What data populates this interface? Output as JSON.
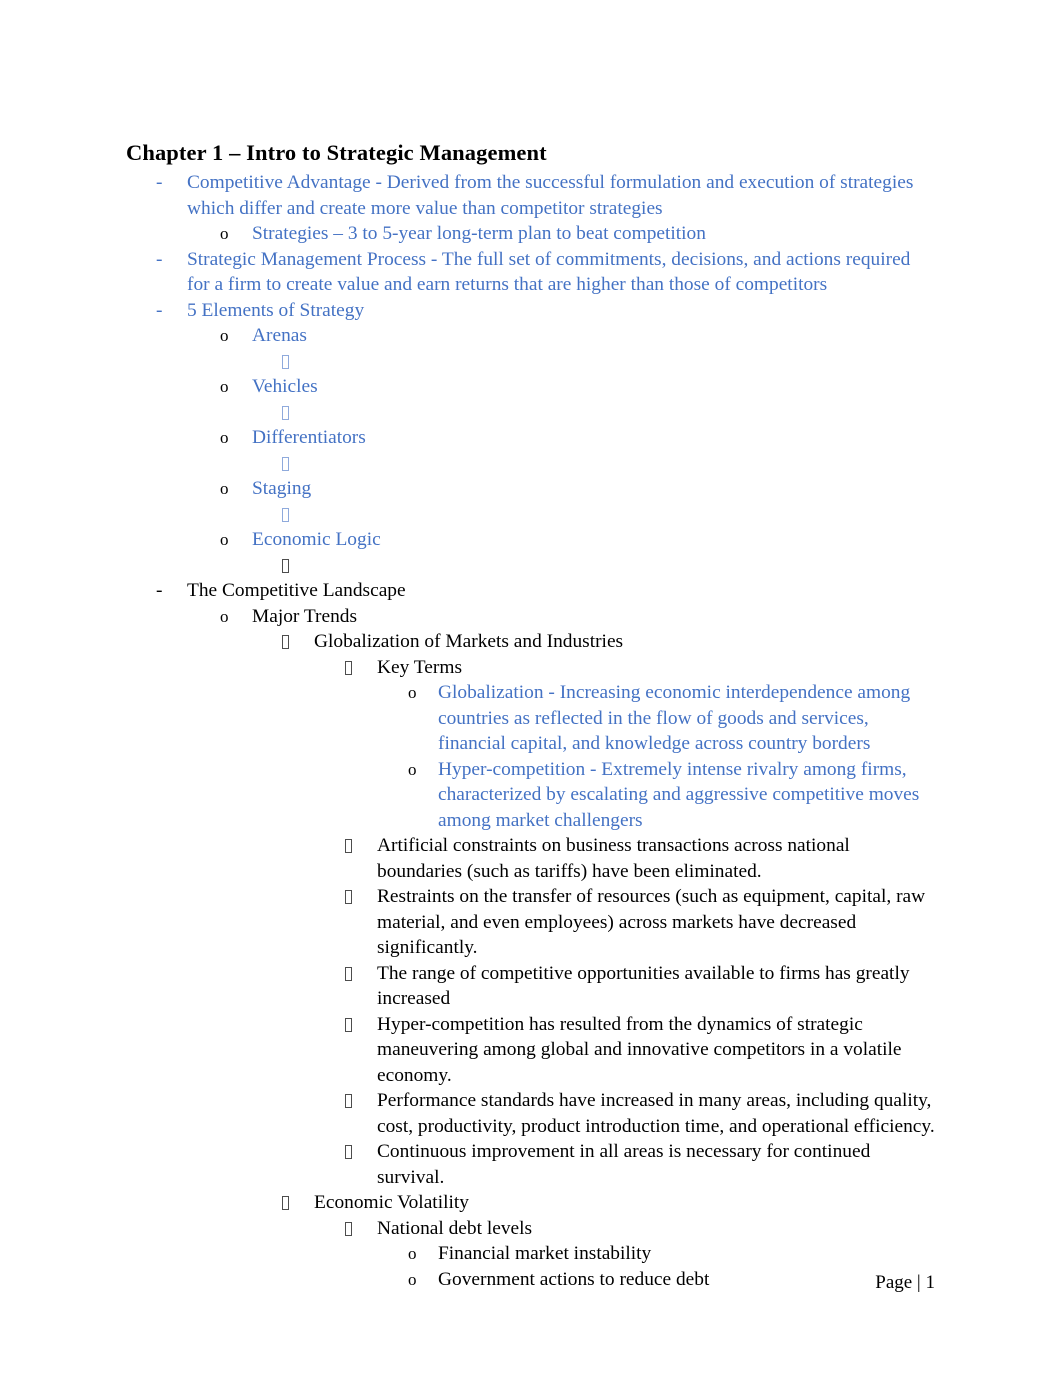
{
  "document": {
    "title": "Chapter 1 – Intro to Strategic Management",
    "accent_color": "#4472C4",
    "text_color": "#000000",
    "background_color": "#FFFFFF"
  },
  "footer": {
    "page_label": "Page | 1"
  },
  "outline": {
    "items": [
      {
        "level": 1,
        "bullet": "dash",
        "color": "blue",
        "text": "Competitive Advantage  - Derived from the successful formulation and execution of strategies which differ and create more value than competitor strategies"
      },
      {
        "level": 2,
        "bullet": "o",
        "color": "blue",
        "text": "Strategies – 3 to 5-year long-term plan to beat competition"
      },
      {
        "level": 1,
        "bullet": "dash",
        "color": "blue",
        "text": "Strategic Management Process   - The full set of commitments, decisions, and actions required for a firm to create value and earn returns that are higher than those of competitors"
      },
      {
        "level": 1,
        "bullet": "dash",
        "color": "blue",
        "text": "5 Elements of Strategy"
      },
      {
        "level": 2,
        "bullet": "o",
        "color": "blue",
        "text": "Arenas"
      },
      {
        "level": 3,
        "bullet": "tofu",
        "color": "blue",
        "text": ""
      },
      {
        "level": 2,
        "bullet": "o",
        "color": "blue",
        "text": "Vehicles"
      },
      {
        "level": 3,
        "bullet": "tofu",
        "color": "blue",
        "text": ""
      },
      {
        "level": 2,
        "bullet": "o",
        "color": "blue",
        "text": "Differentiators"
      },
      {
        "level": 3,
        "bullet": "tofu",
        "color": "blue",
        "text": ""
      },
      {
        "level": 2,
        "bullet": "o",
        "color": "blue",
        "text": "Staging"
      },
      {
        "level": 3,
        "bullet": "tofu",
        "color": "blue",
        "text": ""
      },
      {
        "level": 2,
        "bullet": "o",
        "color": "blue",
        "text": "Economic Logic"
      },
      {
        "level": 3,
        "bullet": "tofu-dark",
        "color": "black",
        "text": ""
      },
      {
        "level": 1,
        "bullet": "dash",
        "color": "black",
        "text": "The Competitive Landscape"
      },
      {
        "level": 2,
        "bullet": "o",
        "color": "black",
        "text": "Major Trends"
      },
      {
        "level": 3,
        "bullet": "tofu-dark",
        "color": "black",
        "text": "Globalization of Markets and Industries"
      },
      {
        "level": 4,
        "bullet": "tofu-dark",
        "color": "black",
        "text": "Key Terms"
      },
      {
        "level": 5,
        "bullet": "o",
        "color": "blue",
        "text": "Globalization - Increasing economic interdependence among countries as reflected in the flow of goods and services, financial capital, and knowledge across country borders"
      },
      {
        "level": 5,
        "bullet": "o",
        "color": "blue",
        "text": "Hyper-competition  - Extremely intense rivalry among firms, characterized by escalating and aggressive competitive moves among market challengers"
      },
      {
        "level": 4,
        "bullet": "tofu-dark",
        "color": "black",
        "text": "Artificial constraints on business transactions across national boundaries (such as tariffs) have been eliminated."
      },
      {
        "level": 4,
        "bullet": "tofu-dark",
        "color": "black",
        "text": "Restraints on the transfer of resources (such as equipment, capital, raw material, and even employees) across markets have decreased significantly."
      },
      {
        "level": 4,
        "bullet": "tofu-dark",
        "color": "black",
        "text": "The range of competitive opportunities available to firms has greatly increased"
      },
      {
        "level": 4,
        "bullet": "tofu-dark",
        "color": "black",
        "text": "Hyper-competition has resulted from the dynamics of strategic maneuvering among global and innovative competitors in a volatile economy."
      },
      {
        "level": 4,
        "bullet": "tofu-dark",
        "color": "black",
        "text": "Performance standards have increased in many areas, including quality, cost, productivity, product introduction time, and operational efficiency."
      },
      {
        "level": 4,
        "bullet": "tofu-dark",
        "color": "black",
        "text": "Continuous improvement in all areas is necessary for continued survival."
      },
      {
        "level": 3,
        "bullet": "tofu-dark",
        "color": "black",
        "text": "Economic Volatility"
      },
      {
        "level": 4,
        "bullet": "tofu-dark",
        "color": "black",
        "text": "National debt levels"
      },
      {
        "level": 5,
        "bullet": "o",
        "color": "black",
        "text": "Financial market instability"
      },
      {
        "level": 5,
        "bullet": "o",
        "color": "black",
        "text": "Government actions to reduce debt"
      }
    ]
  }
}
